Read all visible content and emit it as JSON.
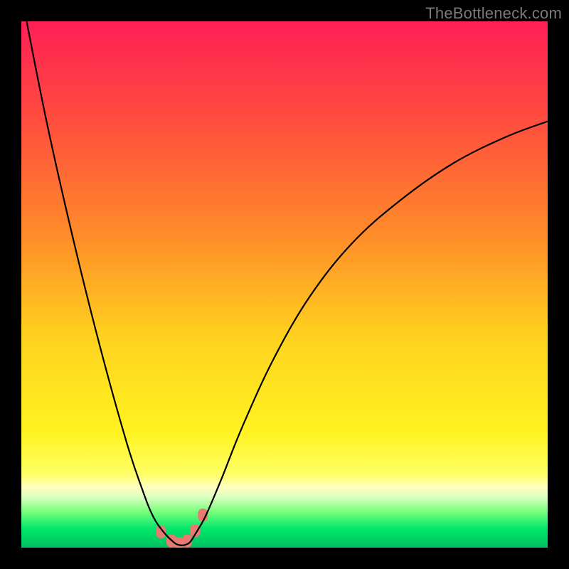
{
  "watermark": "TheBottleneck.com",
  "chart_data": {
    "type": "line",
    "title": "",
    "xlabel": "",
    "ylabel": "",
    "xlim": [
      0,
      100
    ],
    "ylim": [
      0,
      100
    ],
    "grid": false,
    "legend": false,
    "notes": "Bottleneck-style curve plotted over a vertical red→yellow gradient with a green band at the bottom. The curve descends steeply from top-left, reaches ~0 near x≈30, then rises with diminishing slope toward the right edge. Small salmon blobs mark the trough. No axis ticks or numeric labels are shown.",
    "series": [
      {
        "name": "curve",
        "x": [
          1,
          5,
          10,
          15,
          20,
          23,
          25,
          27,
          29,
          30,
          31,
          32,
          33,
          35,
          38,
          42,
          48,
          55,
          63,
          72,
          82,
          92,
          100
        ],
        "y": [
          100,
          80,
          58,
          38,
          20,
          11,
          6,
          3,
          1,
          0.5,
          0.5,
          1,
          2.5,
          6,
          13,
          23,
          36,
          48,
          58,
          66,
          73,
          78,
          81
        ]
      }
    ],
    "markers": [
      {
        "x": 26.5,
        "y": 3.0
      },
      {
        "x": 28.5,
        "y": 1.3
      },
      {
        "x": 30.0,
        "y": 0.8
      },
      {
        "x": 31.5,
        "y": 1.3
      },
      {
        "x": 33.0,
        "y": 3.2
      },
      {
        "x": 34.5,
        "y": 6.2
      }
    ],
    "gradient_stops": [
      {
        "offset": 0.0,
        "color": "#ff1f55"
      },
      {
        "offset": 0.18,
        "color": "#ff4b3f"
      },
      {
        "offset": 0.4,
        "color": "#ff8a2a"
      },
      {
        "offset": 0.6,
        "color": "#ffd21f"
      },
      {
        "offset": 0.78,
        "color": "#fff320"
      },
      {
        "offset": 0.86,
        "color": "#ffff66"
      },
      {
        "offset": 0.885,
        "color": "#ffffc0"
      },
      {
        "offset": 0.905,
        "color": "#d8ffc0"
      },
      {
        "offset": 0.93,
        "color": "#7dff7d"
      },
      {
        "offset": 0.965,
        "color": "#00e66b"
      },
      {
        "offset": 1.0,
        "color": "#00c060"
      }
    ],
    "marker_color": "#e77a71",
    "curve_color": "#000000"
  }
}
